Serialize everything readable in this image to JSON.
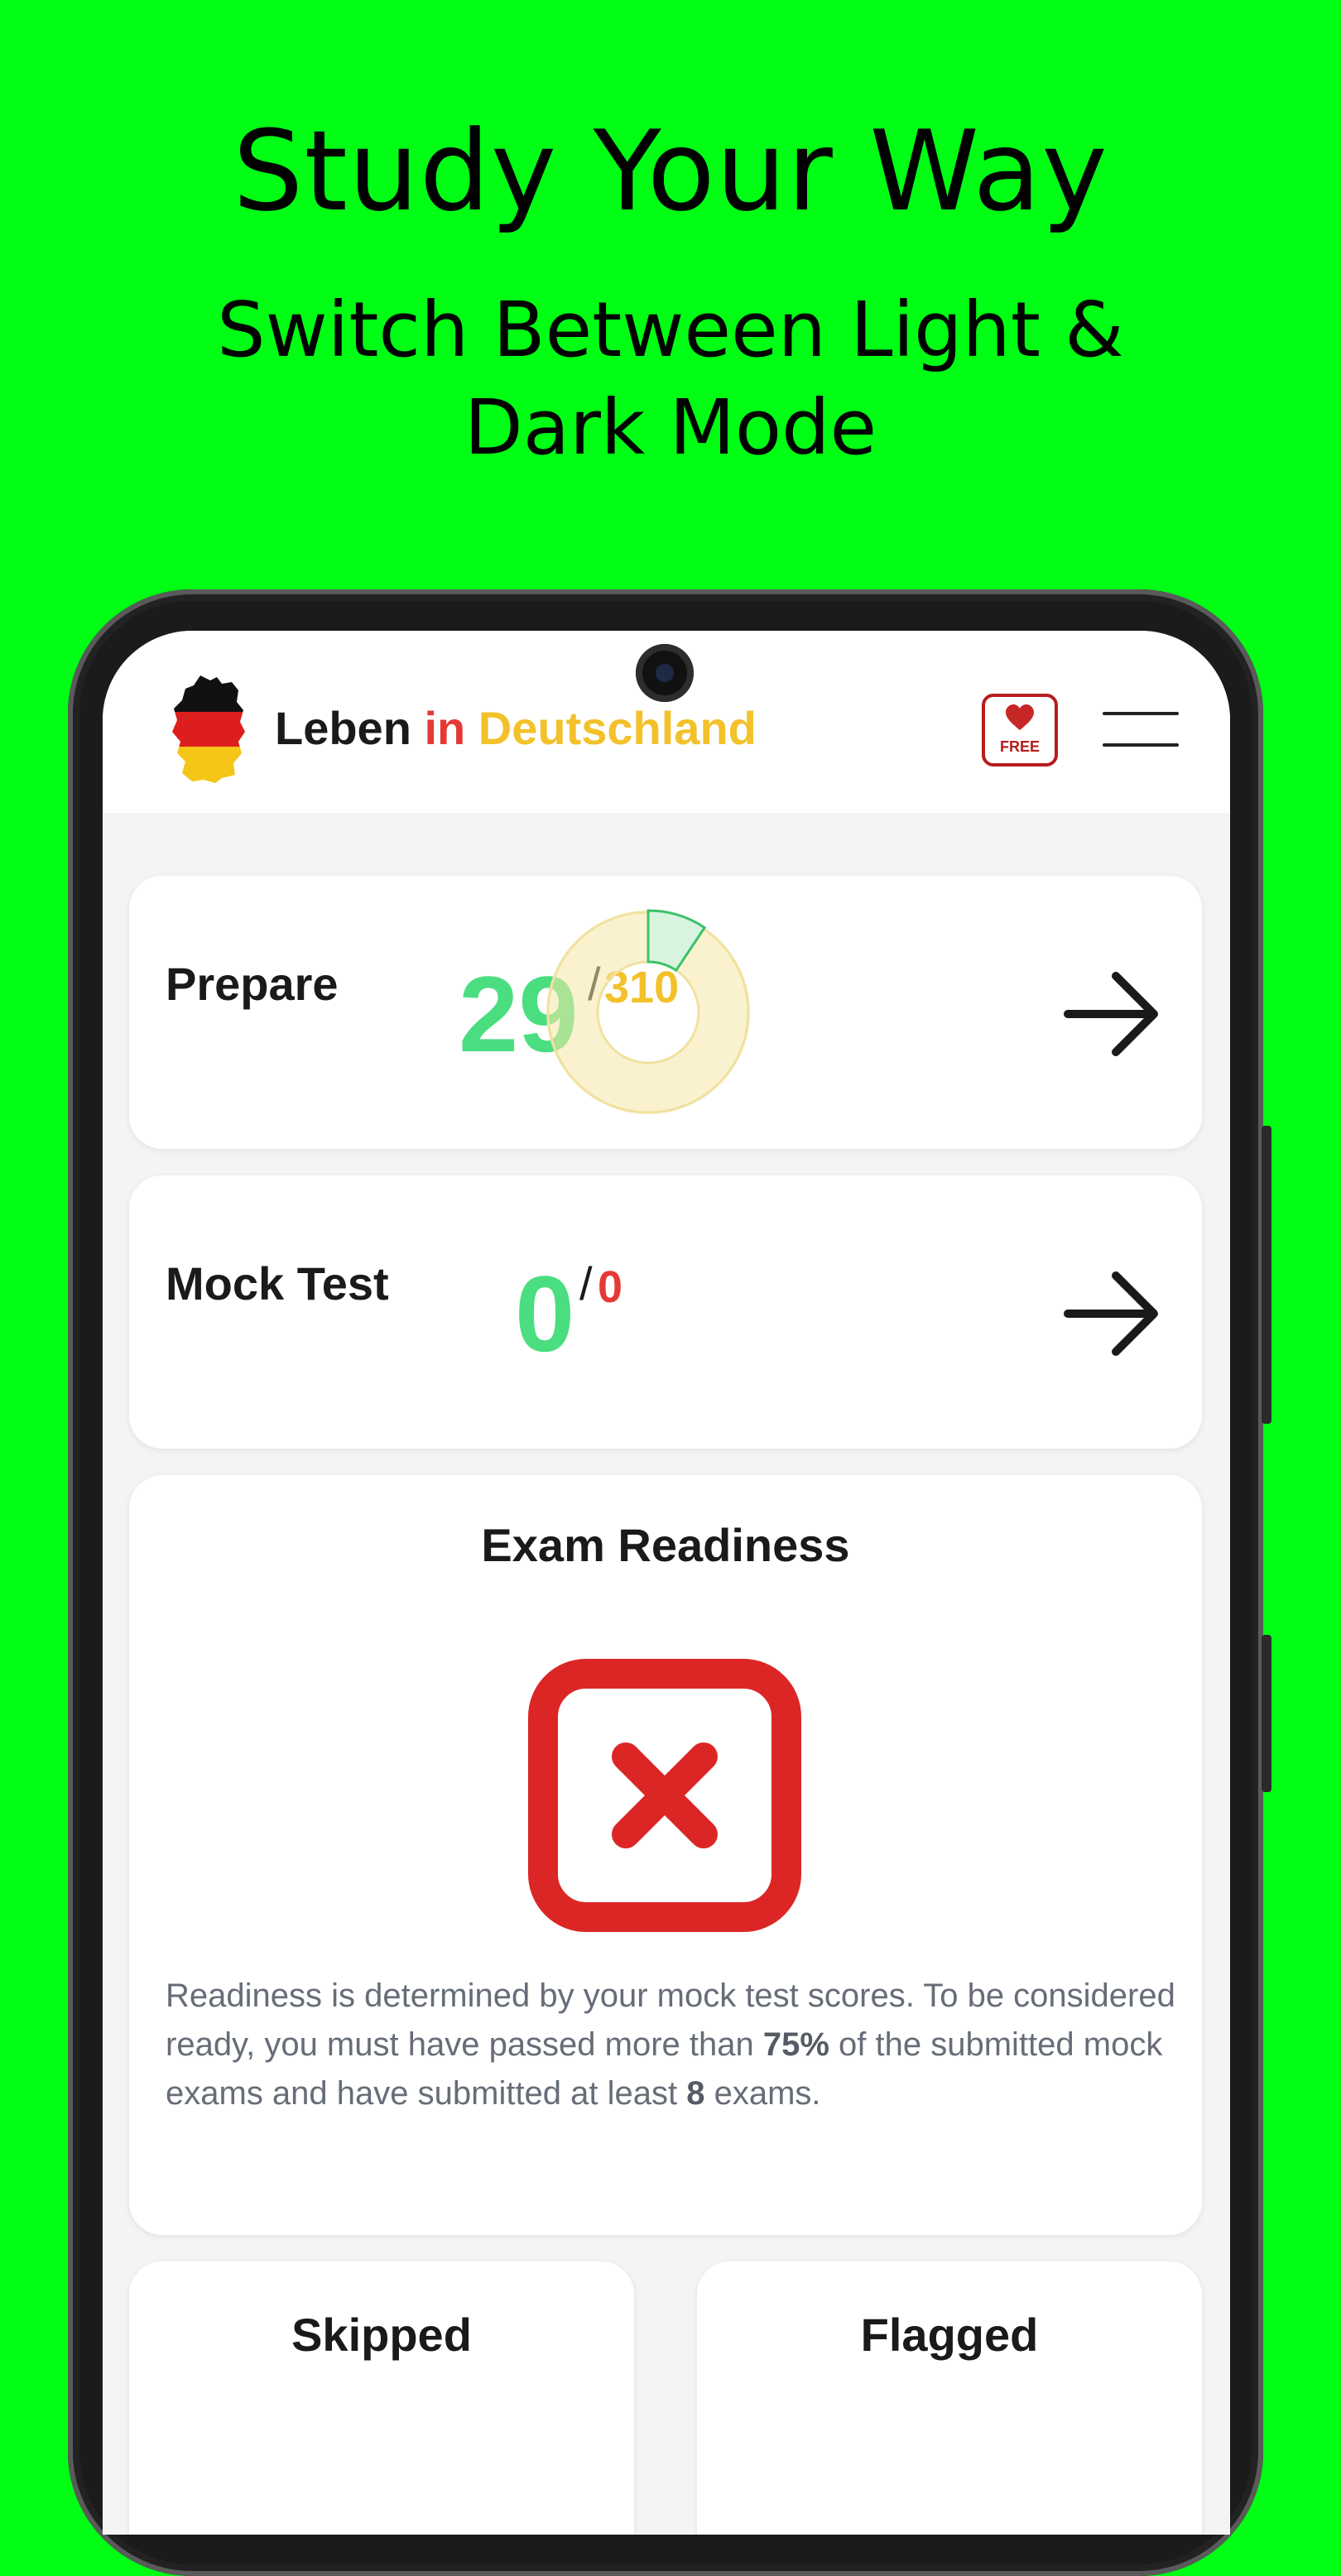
{
  "promo": {
    "headline": "Study Your Way",
    "subheadline": "Switch Between Light & Dark Mode"
  },
  "app": {
    "title_part1": "Leben ",
    "title_part2": "in ",
    "title_part3": "Deutschland",
    "free_badge": "FREE"
  },
  "prepare": {
    "label": "Prepare",
    "done": "29",
    "slash": "/",
    "total": "310",
    "progress_fraction": 0.0935
  },
  "mock_test": {
    "label": "Mock Test",
    "done": "0",
    "slash": "/",
    "total": "0"
  },
  "readiness": {
    "title": "Exam Readiness",
    "status": "not-ready",
    "text_1": "Readiness is determined by your mock test scores. To be considered ready, you must have passed more than ",
    "pct": "75%",
    "text_2": " of the submitted mock exams and have submitted at least ",
    "count": "8",
    "text_3": " exams."
  },
  "bottom_cards": {
    "skipped": "Skipped",
    "flagged": "Flagged"
  },
  "colors": {
    "background": "#00FF14",
    "accent_green": "#4ade80",
    "accent_yellow": "#f3c12a",
    "accent_red": "#e53935",
    "x_red": "#dc2626"
  },
  "icons": {
    "germany_map": "germany-flag-map-icon",
    "free": "heart-free-icon",
    "menu": "hamburger-menu-icon",
    "arrow": "arrow-right-icon",
    "readiness": "x-square-icon"
  }
}
